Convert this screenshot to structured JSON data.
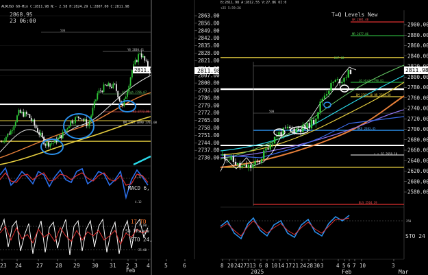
{
  "left": {
    "header": "AUXUSD 60-Min C:2811.98 N:- 2.58 H:2824.29 L:2807.00 C:2811.98",
    "price_label": "2868.95",
    "date_label": "23 06:00",
    "price_axis": [
      "2863.00",
      "2856.00",
      "2849.00",
      "2842.00",
      "2835.00",
      "2828.00",
      "2821.00",
      "2814.00",
      "2807.00",
      "2800.00",
      "2793.00",
      "2786.00",
      "2779.00",
      "2772.00",
      "2765.00",
      "2758.00",
      "2751.00",
      "2744.00",
      "2737.00",
      "2730.00"
    ],
    "last_price": "2811.98",
    "x_ticks": [
      "23",
      "24",
      "27",
      "28",
      "29",
      "30",
      "31",
      "2",
      "3",
      "4",
      "5",
      "6"
    ],
    "month_label": "Feb",
    "line_notes": {
      "n500": "500",
      "y8": "Y8 2830.41",
      "lo_high": "L0 High 2796.07",
      "r1": "R1 2772.00",
      "dm": "DM 2763.10",
      "r0": "R0 2761.00"
    },
    "macd_label": "MACD 6,",
    "macd_vals": [
      "4.12",
      "4.12"
    ],
    "td_label": "17 TD",
    "yrange_label": "58 YRange",
    "sto_label": "STO 24,",
    "sto_levels": [
      "75.00",
      "25.00"
    ]
  },
  "right": {
    "header": "B:2811.98 A:2812.55 V:27.8K OI:0",
    "subheader": "+25 5:59:26",
    "title": "T=Q Levels New",
    "price_axis": [
      "2900.00",
      "2880.00",
      "2860.00",
      "2840.00",
      "2820.00",
      "2800.00",
      "2780.00",
      "2760.00",
      "2740.00",
      "2720.00",
      "2700.00",
      "2680.00",
      "2660.00",
      "2640.00",
      "2620.00",
      "2600.00",
      "2580.00"
    ],
    "last_price": "2811.98",
    "x_ticks": [
      "8",
      "20",
      "24",
      "27",
      "31",
      "3",
      "6",
      "8",
      "10",
      "14",
      "17",
      "21",
      "24",
      "28",
      "30",
      "3",
      "4",
      "5",
      "6",
      "7",
      "10",
      "3"
    ],
    "year_label": "2025",
    "month_label": "Feb",
    "mar_label": "Mar",
    "line_notes": {
      "gr": "GR 2881.48",
      "mr": "MR 2877.06",
      "lo_high": "LO High 2790.01",
      "dm_or": "DM 2763.10 OR 2763.60",
      "n500": "500",
      "bko": "BKO 2683.45",
      "sf": "SF 2658.18",
      "dots": "• •",
      "bls": "BLS 2564.19",
      "n247": "247 68"
    },
    "osc_level": "250",
    "sto_label": "STO 24"
  },
  "chart_data": [
    {
      "type": "candlestick",
      "title": "",
      "timeframe": "60-Min",
      "ylim": [
        2726,
        2870
      ],
      "x_ticks": [
        "23",
        "24",
        "27",
        "28",
        "29",
        "30",
        "31",
        "2",
        "3",
        "4",
        "5",
        "6"
      ],
      "close_path": [
        {
          "x": "23",
          "y": 2745
        },
        {
          "x": "23",
          "y": 2755
        },
        {
          "x": "24",
          "y": 2772
        },
        {
          "x": "24",
          "y": 2770
        },
        {
          "x": "27",
          "y": 2758
        },
        {
          "x": "27",
          "y": 2743
        },
        {
          "x": "28",
          "y": 2744
        },
        {
          "x": "28",
          "y": 2752
        },
        {
          "x": "29",
          "y": 2764
        },
        {
          "x": "29",
          "y": 2769
        },
        {
          "x": "30",
          "y": 2760
        },
        {
          "x": "30",
          "y": 2790
        },
        {
          "x": "31",
          "y": 2797
        },
        {
          "x": "31",
          "y": 2797
        },
        {
          "x": "2",
          "y": 2777
        },
        {
          "x": "2",
          "y": 2812
        },
        {
          "x": "3",
          "y": 2829
        },
        {
          "x": "3",
          "y": 2812
        }
      ],
      "horizontal_levels": [
        2830.41,
        2796.07,
        2772.0,
        2763.1,
        2761.0
      ],
      "last": 2811.98
    },
    {
      "type": "candlestick",
      "title": "T=Q Levels New",
      "timeframe": "Daily",
      "ylim": [
        2560,
        2910
      ],
      "close_path": [
        {
          "x": "8",
          "y": 2650
        },
        {
          "x": "20",
          "y": 2642
        },
        {
          "x": "27",
          "y": 2628
        },
        {
          "x": "31",
          "y": 2628
        },
        {
          "x": "3",
          "y": 2640
        },
        {
          "x": "8",
          "y": 2668
        },
        {
          "x": "10",
          "y": 2690
        },
        {
          "x": "14",
          "y": 2700
        },
        {
          "x": "17",
          "y": 2700
        },
        {
          "x": "21",
          "y": 2702
        },
        {
          "x": "24",
          "y": 2715
        },
        {
          "x": "28",
          "y": 2760
        },
        {
          "x": "30",
          "y": 2790
        },
        {
          "x": "3",
          "y": 2795
        },
        {
          "x": "4",
          "y": 2812
        }
      ],
      "horizontal_levels": [
        2881.48,
        2877.06,
        2790.01,
        2763.6,
        2683.45,
        2658.18,
        2564.19
      ],
      "last": 2811.98
    }
  ]
}
